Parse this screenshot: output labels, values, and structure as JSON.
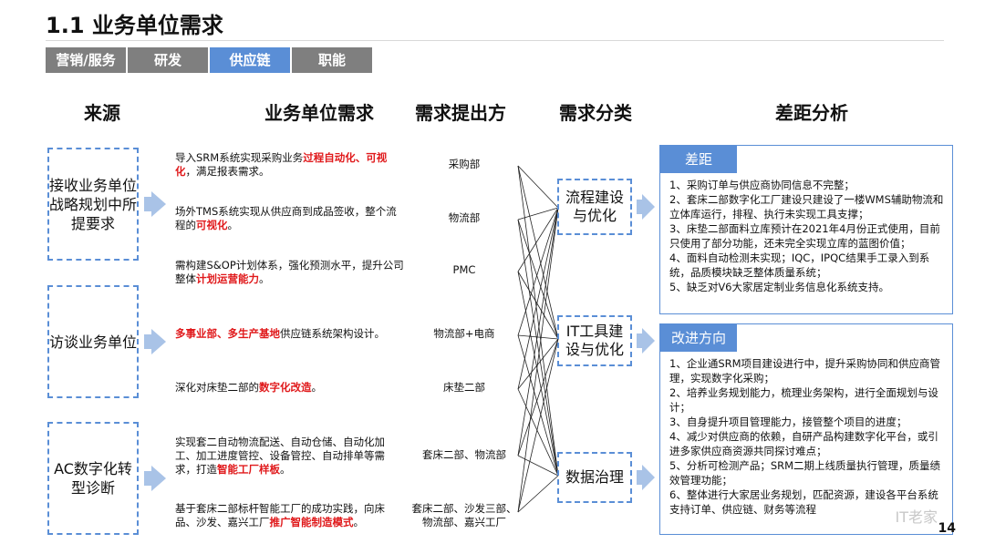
{
  "title": "1.1 业务单位需求",
  "tabs": [
    {
      "label": "营销/服务",
      "active": false
    },
    {
      "label": "研发",
      "active": false
    },
    {
      "label": "供应链",
      "active": true
    },
    {
      "label": "职能",
      "active": false
    }
  ],
  "headers": {
    "source": "来源",
    "need": "业务单位需求",
    "proposer": "需求提出方",
    "category": "需求分类",
    "gap": "差距分析"
  },
  "sources": [
    "接收业务单位战略规划中所提要求",
    "访谈业务单位",
    "AC数字化转型诊断"
  ],
  "needs": [
    {
      "parts": [
        {
          "t": "导入SRM系统实现采购业务",
          "red": false
        },
        {
          "t": "过程自动化、可视化",
          "red": true
        },
        {
          "t": "，满足报表需求。",
          "red": false
        }
      ]
    },
    {
      "parts": [
        {
          "t": "场外TMS系统实现从供应商到成品签收，整个流程的",
          "red": false
        },
        {
          "t": "可视化",
          "red": true
        },
        {
          "t": "。",
          "red": false
        }
      ]
    },
    {
      "parts": [
        {
          "t": "需构建S&OP计划体系，强化预测水平，提升公司整体",
          "red": false
        },
        {
          "t": "计划运营能力",
          "red": true
        },
        {
          "t": "。",
          "red": false
        }
      ]
    },
    {
      "parts": [
        {
          "t": "多事业部、多生产基地",
          "red": true
        },
        {
          "t": "供应链系统架构设计。",
          "red": false
        }
      ]
    },
    {
      "parts": [
        {
          "t": "深化对床垫二部的",
          "red": false
        },
        {
          "t": "数字化改造",
          "red": true
        },
        {
          "t": "。",
          "red": false
        }
      ]
    },
    {
      "parts": [
        {
          "t": "实现套二自动物流配送、自动仓储、自动化加工、加工进度管控、设备管控、自动排单等需求，打造",
          "red": false
        },
        {
          "t": "智能工厂样板",
          "red": true
        },
        {
          "t": "。",
          "red": false
        }
      ]
    },
    {
      "parts": [
        {
          "t": "基于套床二部标杆智能工厂的成功实践，向床品、沙发、嘉兴工厂",
          "red": false
        },
        {
          "t": "推广智能制造模式",
          "red": true
        },
        {
          "t": "。",
          "red": false
        }
      ]
    }
  ],
  "proposers": [
    "采购部",
    "物流部",
    "PMC",
    "物流部+电商",
    "床垫二部",
    "套床二部、物流部",
    "套床二部、沙发三部、物流部、嘉兴工厂"
  ],
  "categories": [
    "流程建设与优化",
    "IT工具建设与优化",
    "数据治理"
  ],
  "gap": {
    "label": "差距",
    "items": [
      "1、采购订单与供应商协同信息不完整；",
      "2、套床二部数字化工厂建设只建设了一楼WMS辅助物流和立体库运行，排程、执行未实现工具支撑；",
      "3、床垫二部面料立库预计在2021年4月份正式使用，目前只使用了部分功能，还未完全实现立库的蓝图价值；",
      "4、面料自动检测未实现；IQC，IPQC结果手工录入到系统，品质模块缺乏整体质量系统；",
      "5、缺乏对V6大家居定制业务信息化系统支持。"
    ]
  },
  "improve": {
    "label": "改进方向",
    "items": [
      "1、企业通SRM项目建设进行中，提升采购协同和供应商管理，实现数字化采购；",
      "2、培养业务规划能力，梳理业务架构，进行全面规划与设计；",
      "3、自身提升项目管理能力，接管整个项目的进度；",
      "4、减少对供应商的依赖，自研产品构建数字化平台，或引进多家供应商资源共同探讨难点；",
      "5、分析可检测产品；SRM二期上线质量执行管理，质量绩效管理功能；",
      "6、整体进行大家居业务规划，匹配资源，建设各平台系统支持订单、供应链、财务等流程"
    ]
  },
  "page_number": "14",
  "watermark": "IT老家"
}
